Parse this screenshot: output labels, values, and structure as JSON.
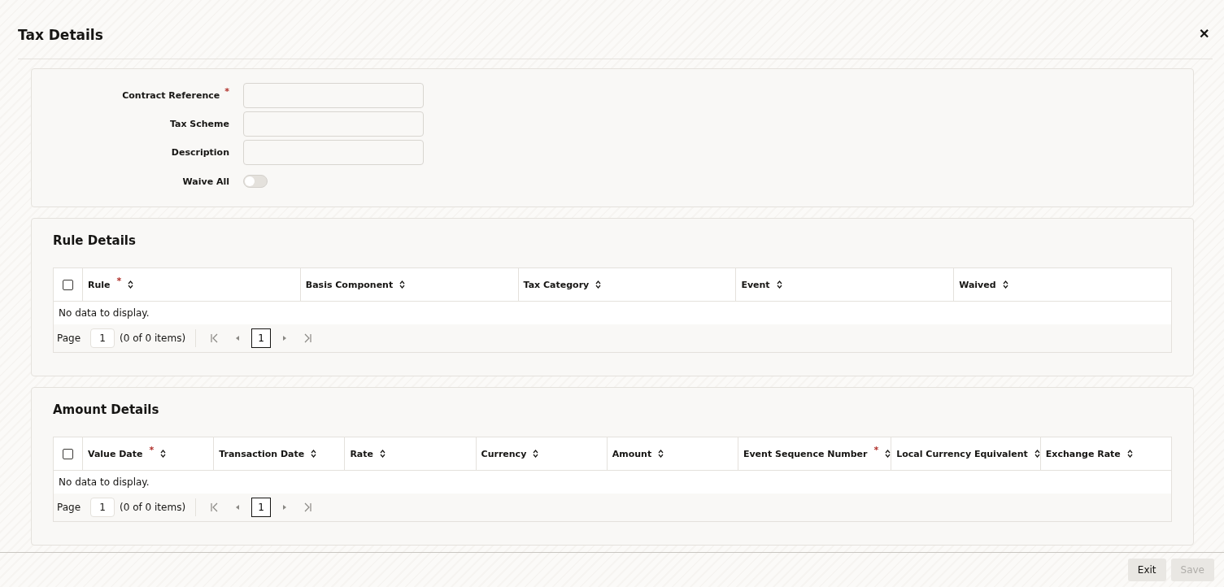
{
  "window": {
    "title": "Tax Details",
    "close": "✕"
  },
  "form": {
    "fields": [
      {
        "kind": "text",
        "label": "Contract Reference",
        "mark": "*"
      },
      {
        "kind": "text",
        "label": "Tax Scheme"
      },
      {
        "kind": "text",
        "label": "Description"
      },
      {
        "kind": "switch",
        "label": "Waive All",
        "on": false
      }
    ]
  },
  "sections": [
    {
      "title": "Rule Details",
      "table": {
        "header_checked": false,
        "columns": [
          {
            "label": "Rule",
            "mark": "*"
          },
          {
            "label": "Basis Component"
          },
          {
            "label": "Tax Category"
          },
          {
            "label": "Event"
          },
          {
            "label": "Waived"
          }
        ],
        "empty": "No data to display.",
        "pager": {
          "label": "Page",
          "page_input": "1",
          "summary": "(0 of 0 items)",
          "current": "1"
        }
      }
    },
    {
      "title": "Amount Details",
      "table": {
        "header_checked": false,
        "columns": [
          {
            "label": "Value Date",
            "mark": "*"
          },
          {
            "label": "Transaction Date"
          },
          {
            "label": "Rate"
          },
          {
            "label": "Currency"
          },
          {
            "label": "Amount"
          },
          {
            "label": "Event Sequence Number",
            "mark": "*"
          },
          {
            "label": "Local Currency Equivalent"
          },
          {
            "label": "Exchange Rate"
          }
        ],
        "empty": "No data to display.",
        "pager": {
          "label": "Page",
          "page_input": "1",
          "summary": "(0 of 0 items)",
          "current": "1"
        }
      }
    }
  ],
  "footer": {
    "buttons": [
      {
        "label": "Exit",
        "disabled": false
      },
      {
        "label": "Save",
        "disabled": true
      }
    ]
  }
}
